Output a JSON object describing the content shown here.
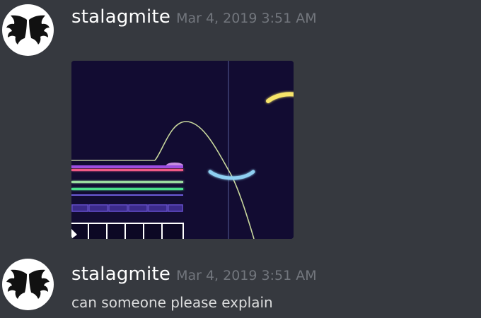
{
  "messages": [
    {
      "username": "stalagmite",
      "timestamp": "Mar 4, 2019 3:51 AM",
      "avatar_icon": "bat-wings-icon",
      "attachment": "game-screenshot"
    },
    {
      "username": "stalagmite",
      "timestamp": "Mar 4, 2019 3:51 AM",
      "avatar_icon": "bat-wings-icon",
      "content": "can someone please explain"
    }
  ],
  "colors": {
    "background": "#36393f",
    "username": "#ffffff",
    "timestamp": "#72767d",
    "message_text": "#dcddde"
  }
}
